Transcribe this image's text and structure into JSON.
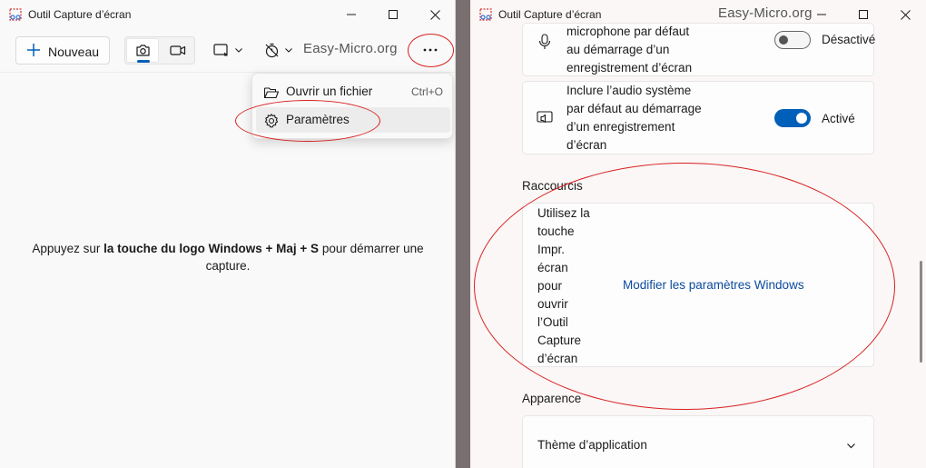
{
  "left_window": {
    "title": "Outil Capture d’écran",
    "new_button": "Nouveau",
    "watermark": "Easy-Micro.org",
    "menu": {
      "open_file": "Ouvrir un fichier",
      "open_file_shortcut": "Ctrl+O",
      "settings": "Paramètres"
    },
    "hint_before": "Appuyez sur ",
    "hint_bold": "la touche du logo Windows + Maj + S",
    "hint_after": " pour démarrer une capture."
  },
  "right_window": {
    "title": "Outil Capture d’écran",
    "watermark": "Easy-Micro.org",
    "mic_setting": {
      "label_lines": [
        "microphone par défaut",
        "au démarrage d’un",
        "enregistrement d’écran"
      ],
      "state": "Désactivé"
    },
    "system_audio_setting": {
      "label_lines": [
        "Inclure l’audio système",
        "par défaut au démarrage",
        "d’un enregistrement",
        "d’écran"
      ],
      "state": "Activé"
    },
    "shortcuts_section": "Raccourcis",
    "shortcut_text_lines": [
      "Utilisez la",
      "touche",
      "Impr.",
      "écran",
      "pour",
      "ouvrir",
      "l’Outil",
      "Capture",
      "d’écran"
    ],
    "shortcut_link": "Modifier les paramètres Windows",
    "appearance_section": "Apparence",
    "theme_label": "Thème d’application"
  },
  "colors": {
    "accent": "#005fb8",
    "annotation_red": "#d92020"
  }
}
